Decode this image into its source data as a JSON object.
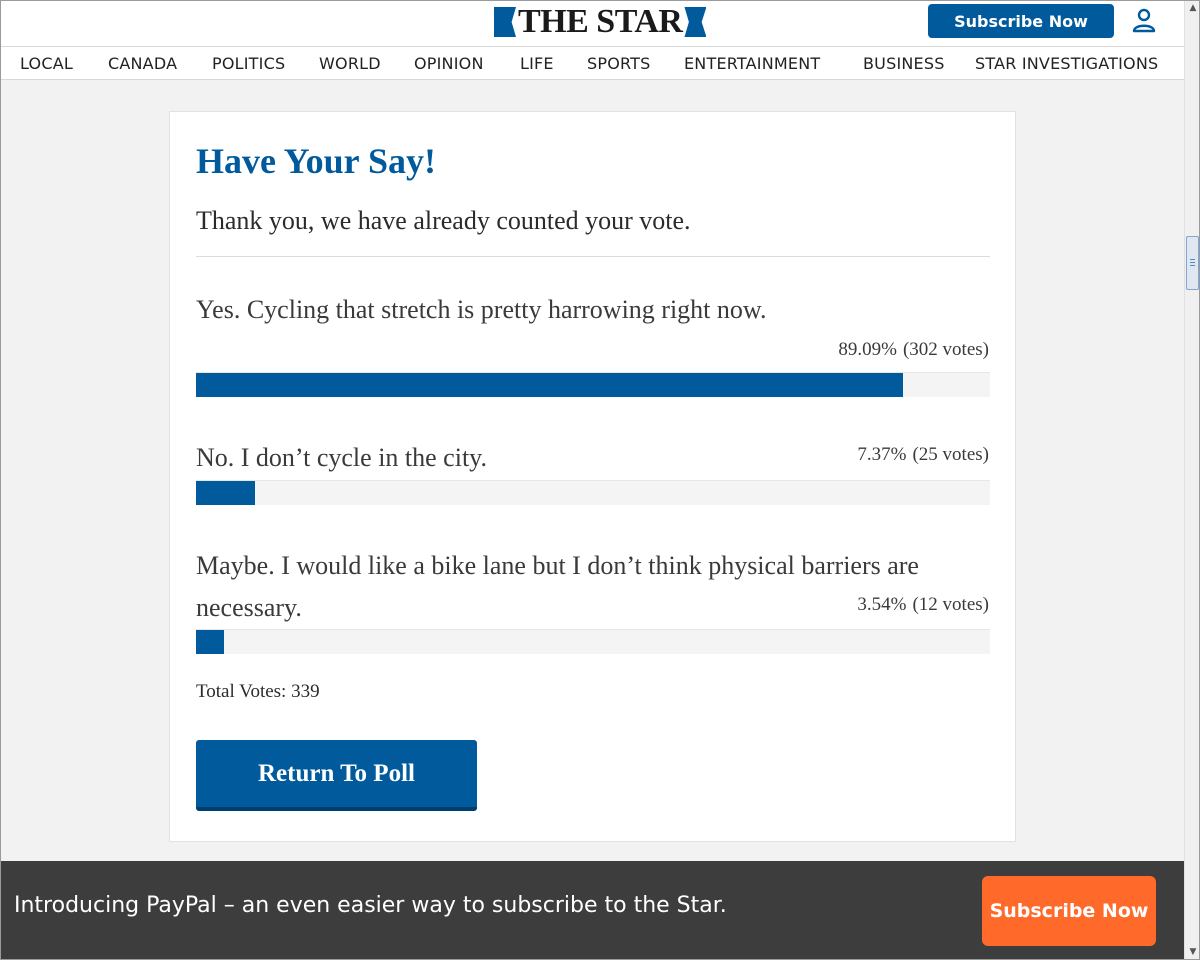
{
  "header": {
    "logo_text": "THE STAR",
    "subscribe_label": "Subscribe Now",
    "account_icon": "user-icon"
  },
  "nav": {
    "items": [
      {
        "label": "LOCAL"
      },
      {
        "label": "CANADA"
      },
      {
        "label": "POLITICS"
      },
      {
        "label": "WORLD"
      },
      {
        "label": "OPINION"
      },
      {
        "label": "LIFE"
      },
      {
        "label": "SPORTS"
      },
      {
        "label": "ENTERTAINMENT"
      },
      {
        "label": "BUSINESS"
      },
      {
        "label": "STAR INVESTIGATIONS"
      }
    ]
  },
  "poll": {
    "title": "Have Your Say!",
    "message": "Thank you, we have already counted your vote.",
    "options": [
      {
        "label": "Yes. Cycling that stretch is pretty harrowing right now.",
        "percent": "89.09%",
        "votes": "(302 votes)",
        "fraction": 0.8909
      },
      {
        "label": "No. I don’t cycle in the city.",
        "percent": "7.37%",
        "votes": "(25 votes)",
        "fraction": 0.0737
      },
      {
        "label": "Maybe. I would like a bike lane but I don’t think physical barriers are necessary.",
        "percent": "3.54%",
        "votes": "(12 votes)",
        "fraction": 0.0354
      }
    ],
    "total_votes": "Total Votes: 339",
    "return_label": "Return To Poll"
  },
  "banner": {
    "text": "Introducing PayPal – an even easier way to subscribe to the Star.",
    "subscribe_label": "Subscribe Now"
  },
  "colors": {
    "brand_blue": "#005a9c",
    "banner_bg": "#3d3d3d",
    "banner_button": "#ff6a2b"
  }
}
